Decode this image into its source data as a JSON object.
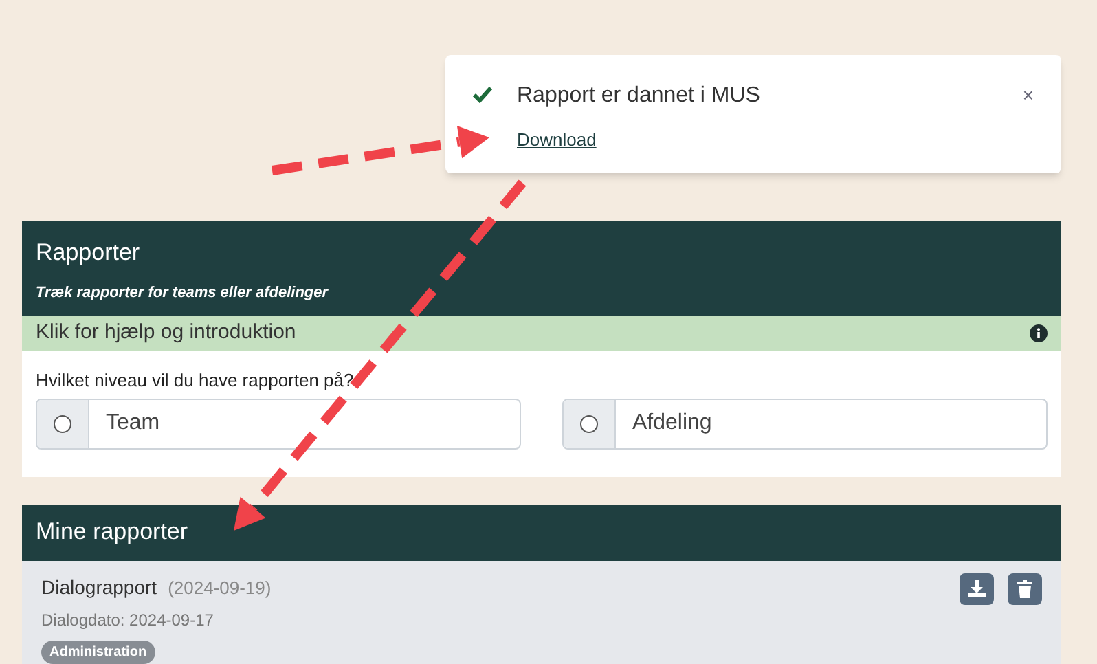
{
  "toast": {
    "message": "Rapport er dannet i MUS",
    "link": "Download",
    "close": "×"
  },
  "reports_panel": {
    "title": "Rapporter",
    "subtitle": "Træk rapporter for teams eller afdelinger",
    "help": "Klik for hjælp og introduktion",
    "question": "Hvilket niveau vil du have rapporten på?",
    "options": [
      {
        "label": "Team",
        "selected": false
      },
      {
        "label": "Afdeling",
        "selected": false
      }
    ]
  },
  "my_reports": {
    "title": "Mine rapporter",
    "items": [
      {
        "name": "Dialograpport",
        "created": "(2024-09-19)",
        "dialog_date": "Dialogdato: 2024-09-17",
        "tag": "Administration"
      }
    ]
  }
}
